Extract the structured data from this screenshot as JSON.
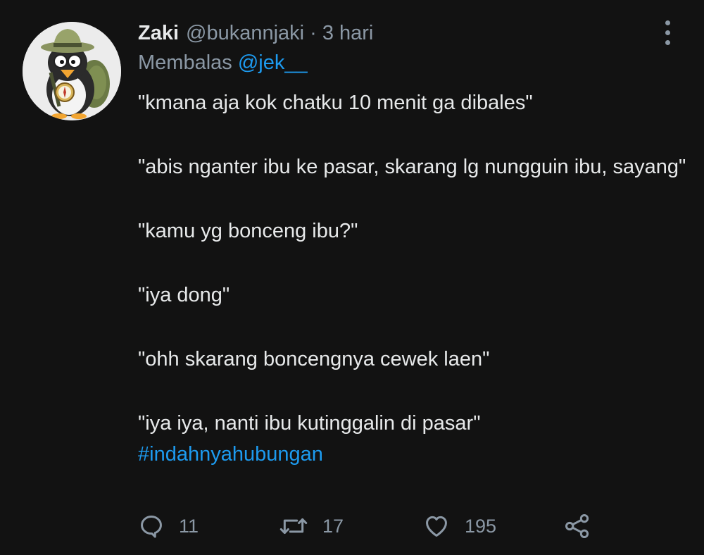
{
  "tweet": {
    "display_name": "Zaki",
    "handle": "@bukannjaki",
    "separator": "·",
    "time": "3 hari",
    "replying_prefix": "Membalas",
    "replying_to": "@jek__",
    "paragraphs": [
      "\"kmana aja kok chatku 10 menit ga dibales\"",
      "\"abis nganter ibu ke pasar, skarang lg nungguin ibu, sayang\"",
      "\"kamu yg bonceng ibu?\"",
      "\"iya dong\"",
      "\"ohh skarang boncengnya cewek laen\"",
      "\"iya iya, nanti ibu kutinggalin di pasar\""
    ],
    "hashtag": "#indahnyahubungan",
    "actions": {
      "replies": "11",
      "retweets": "17",
      "likes": "195"
    }
  },
  "icons": {
    "avatar": "penguin-explorer-avatar",
    "more": "more-vertical-icon",
    "reply": "reply-icon",
    "retweet": "retweet-icon",
    "like": "heart-icon",
    "share": "share-icon"
  },
  "colors": {
    "background": "#121212",
    "text": "#e7e9ea",
    "muted": "#8b98a5",
    "accent": "#1d9bf0"
  }
}
